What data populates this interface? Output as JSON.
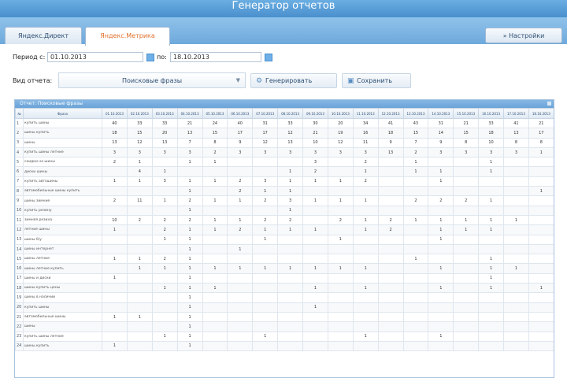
{
  "window": {
    "title": "Генератор отчетов"
  },
  "tabs": [
    {
      "label": "Яндекс.Директ",
      "active": false
    },
    {
      "label": "Яндекс.Метрика",
      "active": true
    }
  ],
  "settings_button": "» Настройки",
  "period": {
    "from_label": "Период с:",
    "from_value": "01.10.2013",
    "to_label": "по:",
    "to_value": "18.10.2013"
  },
  "report": {
    "type_label": "Вид отчета:",
    "type_value": "Поисковые фразы",
    "generate_label": "Генерировать",
    "save_label": "Сохранить"
  },
  "table": {
    "panel_title": "Отчет: Поисковые фразы",
    "headers": [
      "№",
      "Фраза",
      "01.10.2013",
      "02.10.2013",
      "03.10.2013",
      "04.10.2013",
      "05.10.2013",
      "06.10.2013",
      "07.10.2013",
      "08.10.2013",
      "09.10.2013",
      "10.10.2013",
      "11.10.2013",
      "12.10.2013",
      "13.10.2013",
      "14.10.2013",
      "15.10.2013",
      "16.10.2013",
      "17.10.2013",
      "18.10.2013"
    ],
    "rows": [
      {
        "num": "1",
        "phrase": "купить шины",
        "values": [
          "40",
          "33",
          "33",
          "21",
          "24",
          "40",
          "31",
          "33",
          "30",
          "20",
          "34",
          "41",
          "43",
          "31",
          "21",
          "33",
          "41",
          "21"
        ]
      },
      {
        "num": "2",
        "phrase": "шины купить",
        "values": [
          "18",
          "15",
          "20",
          "13",
          "15",
          "17",
          "17",
          "12",
          "21",
          "19",
          "16",
          "18",
          "15",
          "14",
          "15",
          "18",
          "13",
          "17"
        ]
      },
      {
        "num": "3",
        "phrase": "шины",
        "values": [
          "13",
          "12",
          "13",
          "7",
          "8",
          "9",
          "12",
          "13",
          "10",
          "12",
          "11",
          "9",
          "7",
          "9",
          "8",
          "10",
          "8",
          "8"
        ]
      },
      {
        "num": "4",
        "phrase": "купить шины летние",
        "values": [
          "3",
          "3",
          "3",
          "3",
          "2",
          "3",
          "3",
          "3",
          "3",
          "3",
          "3",
          "13",
          "2",
          "3",
          "3",
          "3",
          "3",
          "1"
        ]
      },
      {
        "num": "5",
        "phrase": "скидки на шины",
        "values": [
          "2",
          "1",
          "",
          "1",
          "1",
          "",
          "",
          "",
          "3",
          "",
          "2",
          "",
          "1",
          "",
          "",
          "1",
          "",
          ""
        ]
      },
      {
        "num": "6",
        "phrase": "диски шины",
        "values": [
          "",
          "4",
          "1",
          "",
          "",
          "",
          "",
          "1",
          "2",
          "",
          "1",
          "",
          "1",
          "1",
          "",
          "1",
          "",
          ""
        ]
      },
      {
        "num": "7",
        "phrase": "купить автошины",
        "values": [
          "1",
          "1",
          "3",
          "1",
          "1",
          "2",
          "3",
          "1",
          "1",
          "1",
          "2",
          "",
          "",
          "1",
          "",
          "",
          "",
          ""
        ]
      },
      {
        "num": "8",
        "phrase": "автомобильные шины купить",
        "values": [
          "",
          "",
          "",
          "1",
          "",
          "2",
          "1",
          "1",
          "",
          "",
          "",
          "",
          "",
          "",
          "",
          "",
          "",
          "1"
        ]
      },
      {
        "num": "9",
        "phrase": "шины зимние",
        "values": [
          "2",
          "11",
          "1",
          "2",
          "1",
          "1",
          "2",
          "3",
          "1",
          "1",
          "1",
          "",
          "2",
          "2",
          "2",
          "1",
          "",
          ""
        ]
      },
      {
        "num": "10",
        "phrase": "купить резину",
        "values": [
          "",
          "",
          "",
          "1",
          "",
          "",
          "",
          "1",
          "",
          "",
          "",
          "",
          "",
          "",
          "",
          "",
          "",
          ""
        ]
      },
      {
        "num": "11",
        "phrase": "зимняя резина",
        "values": [
          "10",
          "2",
          "2",
          "2",
          "1",
          "1",
          "2",
          "2",
          "",
          "2",
          "1",
          "2",
          "1",
          "1",
          "1",
          "1",
          "1",
          ""
        ]
      },
      {
        "num": "12",
        "phrase": "летние шины",
        "values": [
          "1",
          "",
          "2",
          "1",
          "1",
          "2",
          "1",
          "1",
          "1",
          "",
          "1",
          "2",
          "",
          "1",
          "1",
          "1",
          "",
          ""
        ]
      },
      {
        "num": "13",
        "phrase": "шины б/у",
        "values": [
          "",
          "",
          "1",
          "1",
          "",
          "",
          "1",
          "",
          "",
          "1",
          "",
          "",
          "",
          "1",
          "",
          "",
          "",
          ""
        ]
      },
      {
        "num": "14",
        "phrase": "шины интернет",
        "values": [
          "",
          "",
          "",
          "1",
          "",
          "1",
          "",
          "",
          "",
          "",
          "",
          "",
          "",
          "",
          "",
          "",
          "",
          ""
        ]
      },
      {
        "num": "15",
        "phrase": "шины летние",
        "values": [
          "1",
          "1",
          "2",
          "1",
          "",
          "",
          "",
          "",
          "",
          "",
          "",
          "",
          "1",
          "",
          "",
          "1",
          "",
          ""
        ]
      },
      {
        "num": "16",
        "phrase": "шины летние купить",
        "values": [
          "",
          "1",
          "1",
          "1",
          "1",
          "1",
          "1",
          "1",
          "1",
          "1",
          "1",
          "",
          "",
          "1",
          "",
          "1",
          "1",
          ""
        ]
      },
      {
        "num": "17",
        "phrase": "шины и диски",
        "values": [
          "1",
          "",
          "",
          "1",
          "",
          "",
          "",
          "",
          "",
          "",
          "",
          "",
          "",
          "",
          "",
          "1",
          "",
          ""
        ]
      },
      {
        "num": "18",
        "phrase": "шины купить цены",
        "values": [
          "",
          "",
          "1",
          "1",
          "1",
          "",
          "",
          "",
          "1",
          "",
          "1",
          "",
          "",
          "1",
          "",
          "1",
          "",
          "1"
        ]
      },
      {
        "num": "19",
        "phrase": "шины в наличии",
        "values": [
          "",
          "",
          "",
          "1",
          "",
          "",
          "",
          "",
          "",
          "",
          "",
          "",
          "",
          "",
          "",
          "",
          "",
          ""
        ]
      },
      {
        "num": "20",
        "phrase": "купить шины",
        "values": [
          "",
          "",
          "",
          "1",
          "",
          "",
          "",
          "",
          "1",
          "",
          "",
          "",
          "",
          "",
          "",
          "",
          "",
          ""
        ]
      },
      {
        "num": "21",
        "phrase": "автомобильные шины",
        "values": [
          "1",
          "1",
          "",
          "1",
          "",
          "",
          "",
          "",
          "",
          "",
          "",
          "",
          "",
          "",
          "",
          "",
          "",
          ""
        ]
      },
      {
        "num": "22",
        "phrase": "шины",
        "values": [
          "",
          "",
          "",
          "1",
          "",
          "",
          "",
          "",
          "",
          "",
          "",
          "",
          "",
          "",
          "",
          "",
          "",
          ""
        ]
      },
      {
        "num": "23",
        "phrase": "купить шины летние",
        "values": [
          "",
          "",
          "1",
          "1",
          "",
          "",
          "1",
          "",
          "",
          "",
          "1",
          "",
          "",
          "1",
          "",
          "",
          "",
          ""
        ]
      },
      {
        "num": "24",
        "phrase": "шины купить",
        "values": [
          "1",
          "",
          "",
          "1",
          "",
          "",
          "",
          "",
          "",
          "",
          "",
          "",
          "",
          "",
          "",
          "",
          "",
          ""
        ]
      }
    ]
  }
}
